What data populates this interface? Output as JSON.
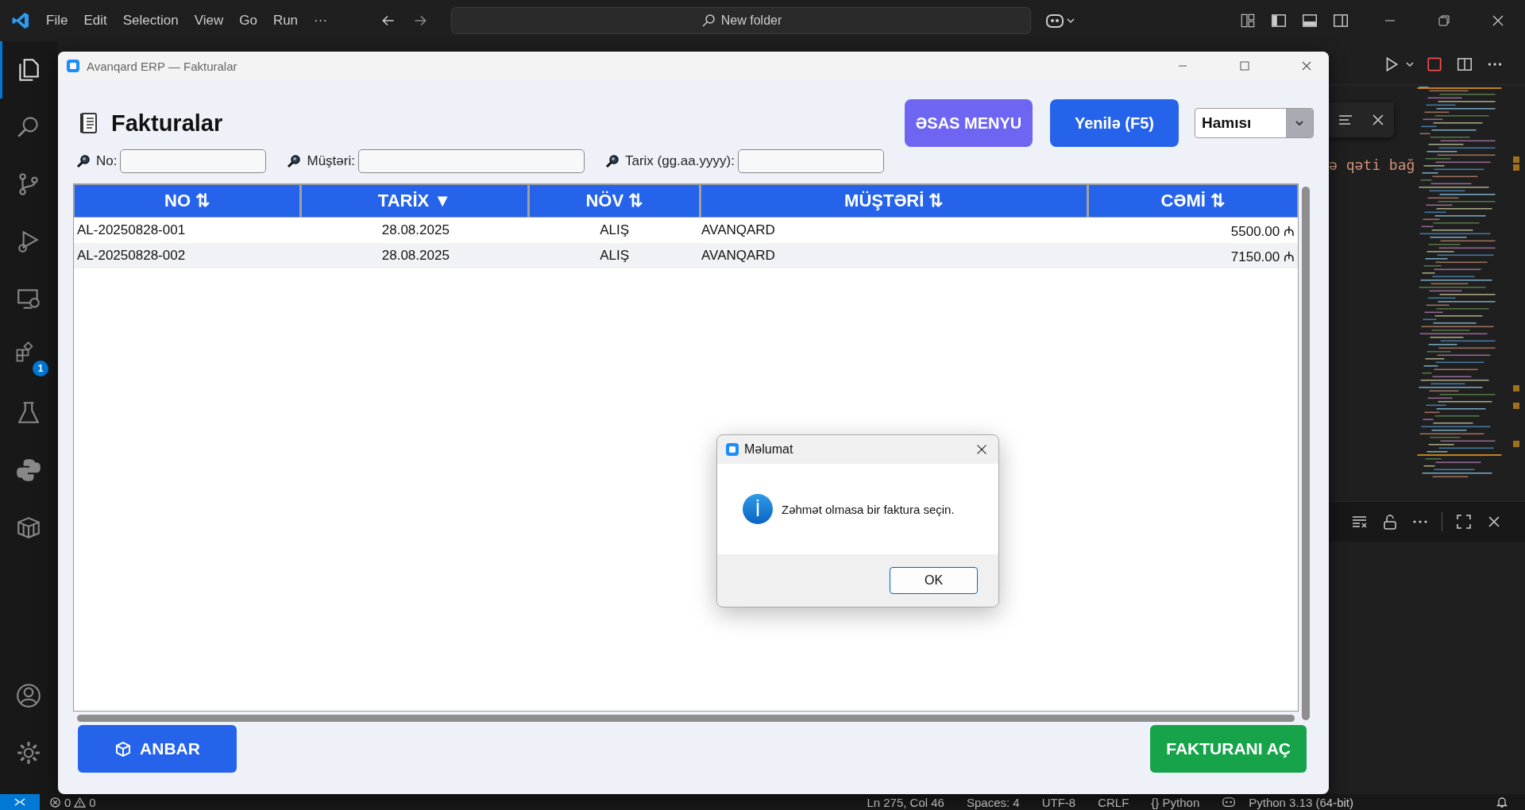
{
  "vscode": {
    "menu": [
      "File",
      "Edit",
      "Selection",
      "View",
      "Go",
      "Run",
      "···"
    ],
    "command_center": {
      "placeholder": "New folder"
    },
    "extensions_badge": "1",
    "editor_text": "ə qəti bağ",
    "status_bar": {
      "problems": [
        {
          "kind": "error",
          "count": "0"
        },
        {
          "kind": "warning",
          "count": "0"
        }
      ],
      "items": [
        "Ln 275, Col 46",
        "Spaces: 4",
        "UTF-8",
        "CRLF",
        "{} Python"
      ],
      "interpreter": "Python 3.13 (64-bit)"
    }
  },
  "window": {
    "title": "Avanqard ERP — Fakturalar"
  },
  "heading": "Fakturalar",
  "buttons": [
    {
      "label": "ƏSAS MENYU",
      "kind": "menu"
    },
    {
      "label": "Yenilə (F5)",
      "kind": "refresh"
    }
  ],
  "filter_select": {
    "value": "Hamısı"
  },
  "filters": [
    {
      "label": "No:"
    },
    {
      "label": "Müştəri:"
    },
    {
      "label": "Tarix (gg.aa.yyyy):"
    }
  ],
  "table": {
    "columns": [
      {
        "label": "NO",
        "sort": "⇅"
      },
      {
        "label": "TARİX",
        "sort": "▼"
      },
      {
        "label": "NÖV",
        "sort": "⇅"
      },
      {
        "label": "MÜŞTƏRİ",
        "sort": "⇅"
      },
      {
        "label": "CƏMİ",
        "sort": "⇅"
      }
    ],
    "rows": [
      [
        "AL-20250828-001",
        "28.08.2025",
        "ALIŞ",
        "AVANQARD",
        "5500.00 ₼"
      ],
      [
        "AL-20250828-002",
        "28.08.2025",
        "ALIŞ",
        "AVANQARD",
        "7150.00 ₼"
      ]
    ]
  },
  "footer_buttons": [
    {
      "label": "ANBAR",
      "kind": "primary"
    },
    {
      "label": "FAKTURANI AÇ",
      "kind": "success"
    }
  ],
  "dialog": {
    "title": "Məlumat",
    "message": "Zəhmət olmasa bir faktura seçin.",
    "button": "OK"
  }
}
